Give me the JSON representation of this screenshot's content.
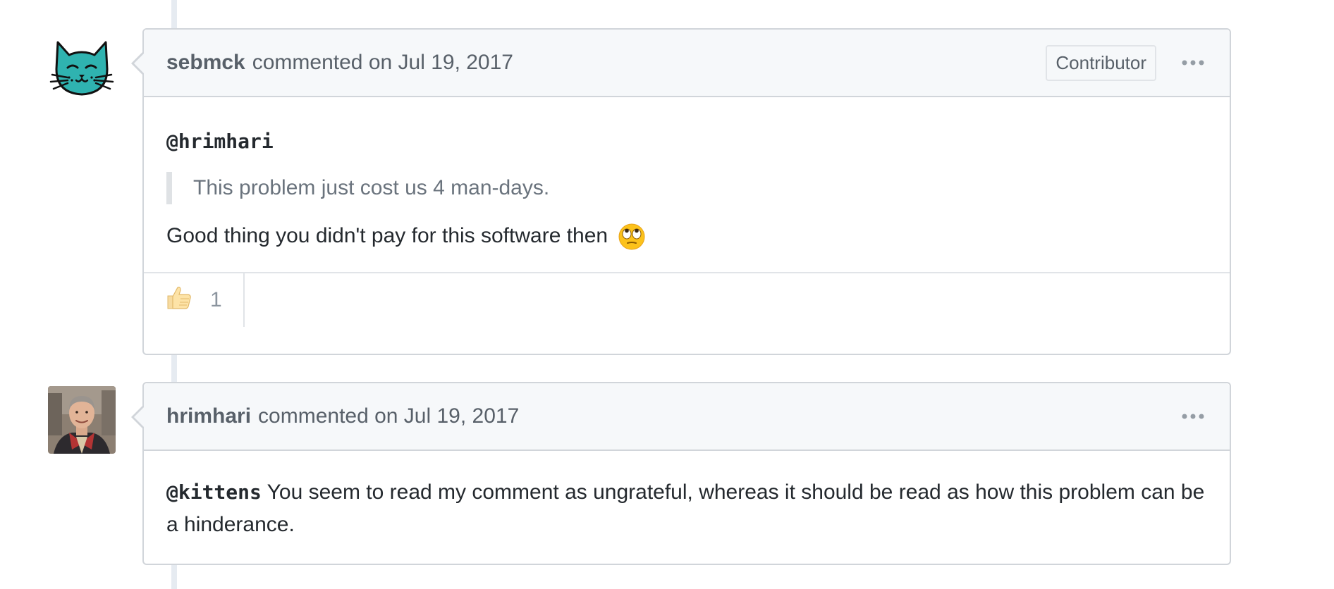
{
  "comments": [
    {
      "author": "sebmck",
      "meta": "commented on Jul 19, 2017",
      "role_badge": "Contributor",
      "avatar_icon": "cat-avatar-icon",
      "mention": "@hrimhari",
      "quote": "This problem just cost us 4 man-days.",
      "text": "Good thing you didn't pay for this software then",
      "emoji": "eye-roll-emoji-icon",
      "reactions": [
        {
          "icon": "thumbs-up-icon",
          "count": "1"
        }
      ]
    },
    {
      "author": "hrimhari",
      "meta": "commented on Jul 19, 2017",
      "avatar_icon": "user-photo-avatar",
      "mention": "@kittens",
      "text": " You seem to read my comment as ungrateful, whereas it should be read as how this problem can be a hinderance."
    }
  ],
  "colors": {
    "header_bg": "#f6f8fa",
    "border": "#d1d5da",
    "cat_teal": "#2fb3b0",
    "timeline": "#e6ebf1"
  }
}
